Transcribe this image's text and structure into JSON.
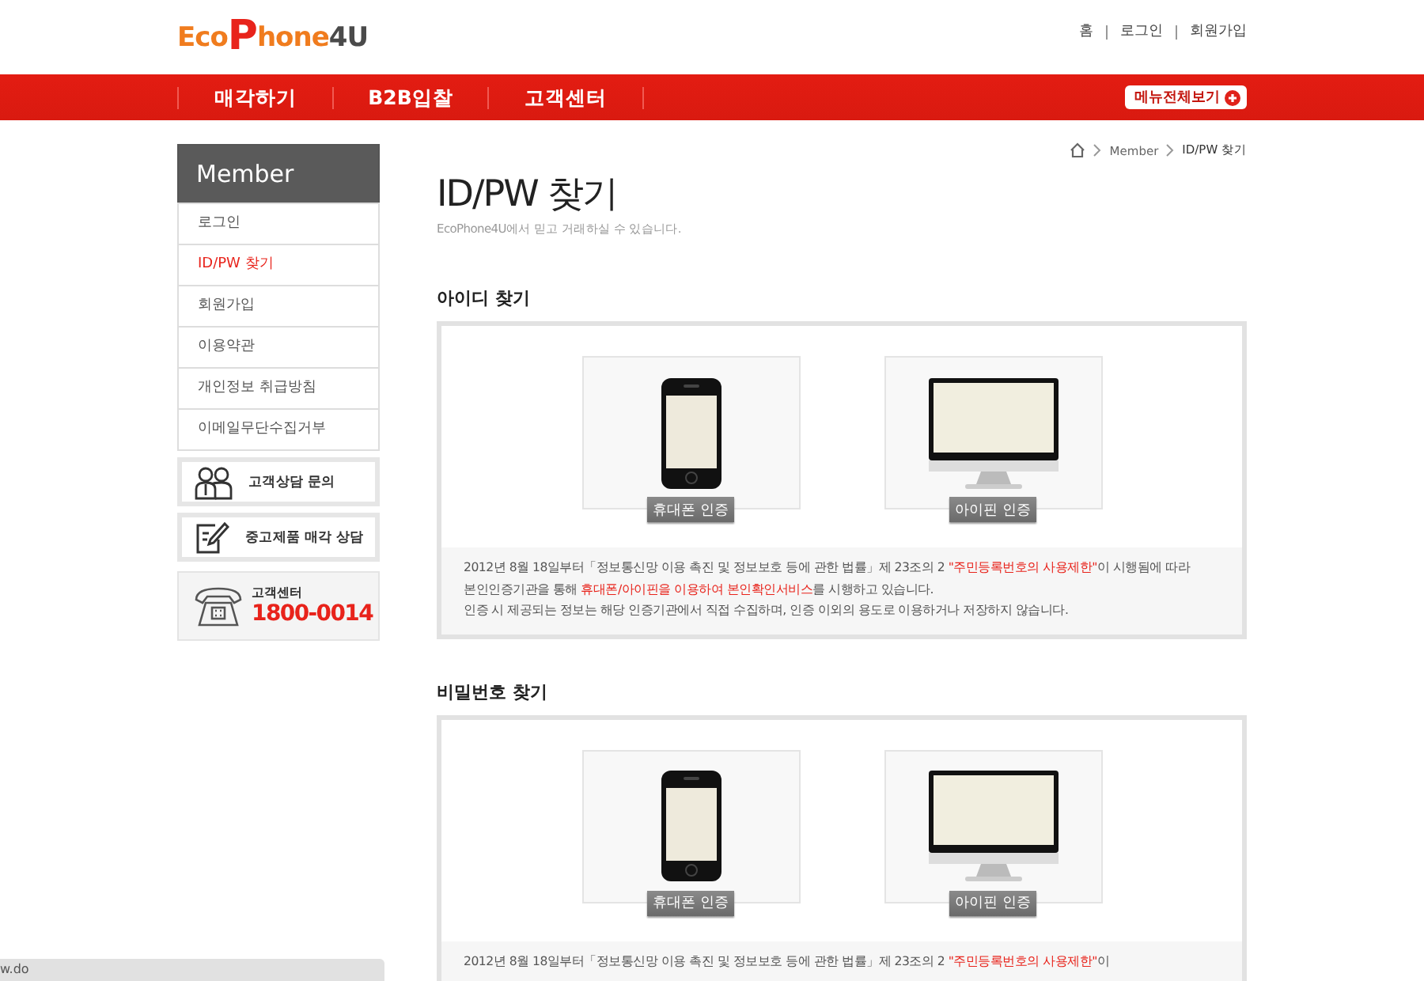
{
  "header": {
    "logo": [
      {
        "text": "Eco",
        "color": "#f07c1e"
      },
      {
        "text": "P",
        "color": "#e8231b"
      },
      {
        "text": "hone",
        "color": "#f07c1e"
      },
      {
        "text": "4U",
        "color": "#4a4a4a"
      }
    ],
    "top_links": [
      "홈",
      "로그인",
      "회원가입"
    ],
    "nav": [
      "매각하기",
      "B2B입찰",
      "고객센터"
    ],
    "menu_all_button": "메뉴전체보기"
  },
  "sidebar": {
    "title": "Member",
    "items": [
      {
        "label": "로그인",
        "selected": false
      },
      {
        "label": "ID/PW 찾기",
        "selected": true
      },
      {
        "label": "회원가입",
        "selected": false
      },
      {
        "label": "이용약관",
        "selected": false
      },
      {
        "label": "개인정보 취급방침",
        "selected": false
      },
      {
        "label": "이메일무단수집거부",
        "selected": false
      }
    ],
    "banners": [
      {
        "kind": "consult",
        "label": "고객상담 문의"
      },
      {
        "kind": "sell",
        "label": "중고제품 매각 상담"
      }
    ],
    "call_center": {
      "label": "고객센터",
      "phone": "1800-0014"
    }
  },
  "breadcrumb": [
    "Member",
    "ID/PW 찾기"
  ],
  "title": "ID/PW 찾기",
  "subtitle": "EcoPhone4U에서 믿고 거래하실 수 있습니다.",
  "sections": [
    {
      "title": "아이디 찾기",
      "options": [
        {
          "kind": "phone",
          "label": "휴대폰 인증"
        },
        {
          "kind": "ipin",
          "label": "아이핀 인증"
        }
      ],
      "notice": [
        [
          {
            "text": "2012년 8월 18일부터「정보통신망 이용 촉진 및 정보보호 등에 관한 법률」제 23조의 2 ",
            "highlight": false
          },
          {
            "text": "\"주민등록번호의 사용제한\"",
            "highlight": true
          },
          {
            "text": "이 시행됨에 따라",
            "highlight": false
          }
        ],
        [
          {
            "text": "본인인증기관을 통해 ",
            "highlight": false
          },
          {
            "text": "휴대폰/아이핀을 이용하여 본인확인서비스",
            "highlight": true
          },
          {
            "text": "를 시행하고 있습니다.",
            "highlight": false
          }
        ],
        [
          {
            "text": "인증 시 제공되는 정보는 해당 인증기관에서 직접 수집하며, 인증 이외의 용도로 이용하거나 저장하지 않습니다.",
            "highlight": false
          }
        ]
      ]
    },
    {
      "title": "비밀번호 찾기",
      "options": [
        {
          "kind": "phone",
          "label": "휴대폰 인증"
        },
        {
          "kind": "ipin",
          "label": "아이핀 인증"
        }
      ],
      "notice": [
        [
          {
            "text": "2012년 8월 18일부터「정보통신망 이용 촉진 및 정보보호 등에 관한 법률」제 23조의 2 ",
            "highlight": false
          },
          {
            "text": "\"주민등록번호의 사용제한\"",
            "highlight": true
          },
          {
            "text": "이",
            "highlight": false
          }
        ]
      ]
    }
  ],
  "status_bar": "w.do"
}
